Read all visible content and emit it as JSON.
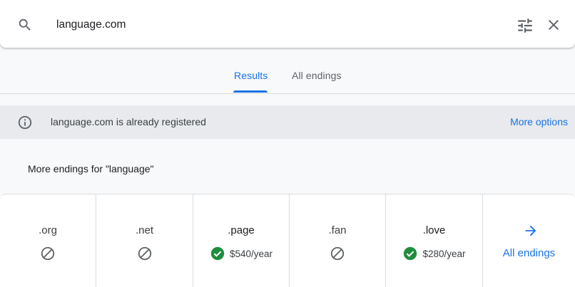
{
  "search": {
    "value": "language.com"
  },
  "tabs": [
    {
      "label": "Results",
      "active": true
    },
    {
      "label": "All endings",
      "active": false
    }
  ],
  "banner": {
    "message": "language.com is already registered",
    "action": "More options"
  },
  "section": {
    "heading": "More endings for \"language\""
  },
  "endings": [
    {
      "tld": ".org",
      "available": false,
      "price": ""
    },
    {
      "tld": ".net",
      "available": false,
      "price": ""
    },
    {
      "tld": ".page",
      "available": true,
      "price": "$540/year"
    },
    {
      "tld": ".fan",
      "available": false,
      "price": ""
    },
    {
      "tld": ".love",
      "available": true,
      "price": "$280/year"
    }
  ],
  "all_endings_link": "All endings",
  "icons": {
    "search": "search-icon",
    "filter": "tune-icon",
    "close": "close-icon",
    "info": "info-icon",
    "unavailable": "block-icon",
    "available": "check-circle-icon",
    "arrow": "arrow-right-icon"
  },
  "colors": {
    "accent": "#1a73e8",
    "available": "#1e8e3e",
    "unavailable_icon": "#5f6368",
    "banner_bg": "#e8eaed"
  }
}
